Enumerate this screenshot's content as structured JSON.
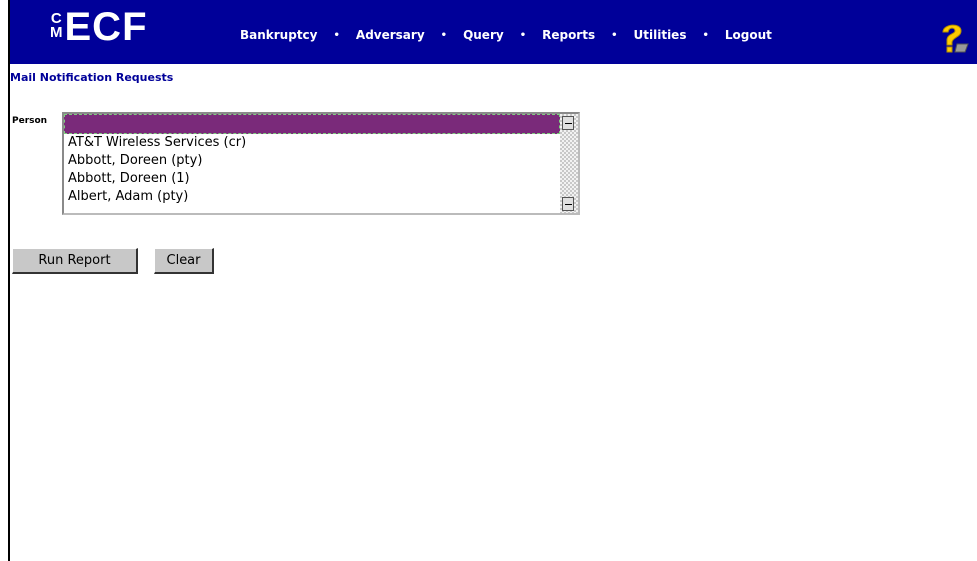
{
  "app": {
    "logo_small": [
      "C",
      "M"
    ],
    "logo_main": "ECF"
  },
  "nav": {
    "items": [
      "Bankruptcy",
      "Adversary",
      "Query",
      "Reports",
      "Utilities",
      "Logout"
    ],
    "separator": "•",
    "help_icon": "question-mark-icon"
  },
  "page": {
    "title": "Mail Notification Requests"
  },
  "form": {
    "person_label": "Person",
    "person_options": [
      "",
      "AT&T Wireless Services (cr)",
      "Abbott, Doreen (pty)",
      "Abbott, Doreen (1)",
      "Albert, Adam (pty)"
    ],
    "selected_index": 0,
    "run_report_label": "Run Report",
    "clear_label": "Clear"
  },
  "colors": {
    "nav_background": "#000099",
    "title_color": "#000099",
    "selected_row": "#7a2a7a"
  }
}
